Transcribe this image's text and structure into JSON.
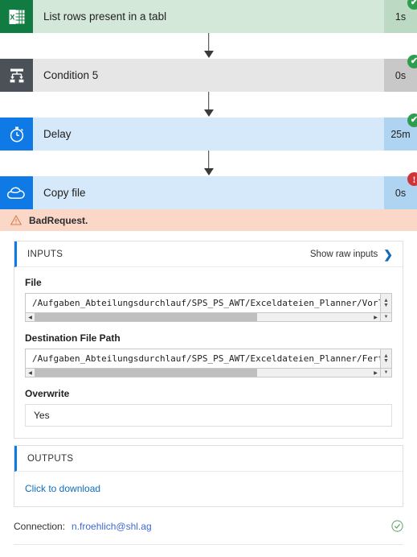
{
  "flow": {
    "steps": [
      {
        "name": "List rows present in a tabl",
        "duration": "1s",
        "status": "success",
        "icon": "excel-icon",
        "theme": "excel"
      },
      {
        "name": "Condition 5",
        "duration": "0s",
        "status": "success",
        "icon": "condition-icon",
        "theme": "condition"
      },
      {
        "name": "Delay",
        "duration": "25m",
        "status": "success",
        "icon": "stopwatch-icon",
        "theme": "blue"
      },
      {
        "name": "Copy file",
        "duration": "0s",
        "status": "error",
        "icon": "onedrive-cloud-icon",
        "theme": "blue"
      }
    ]
  },
  "error_banner": {
    "icon": "warning-triangle-icon",
    "message": "BadRequest."
  },
  "inputs_panel": {
    "title": "INPUTS",
    "raw_link_label": "Show raw inputs",
    "raw_link_icon": "chevron-right-icon",
    "fields": [
      {
        "label": "File",
        "value": "/Aufgaben_Abteilungsdurchlauf/SPS_PS_AWT/Exceldateien_Planner/Vorla",
        "has_scrollbar": true
      },
      {
        "label": "Destination File Path",
        "value": "/Aufgaben_Abteilungsdurchlauf/SPS_PS_AWT/Exceldateien_Planner/Ferti",
        "has_scrollbar": true
      },
      {
        "label": "Overwrite",
        "value": "Yes",
        "has_scrollbar": false
      }
    ]
  },
  "outputs_panel": {
    "title": "OUTPUTS",
    "download_label": "Click to download"
  },
  "connection": {
    "label": "Connection:",
    "account": "n.froehlich@shl.ag",
    "status_icon": "check-circle-icon"
  },
  "colors": {
    "excel_green": "#107c41",
    "excel_body": "#d3e8d8",
    "condition_gray": "#4a5159",
    "blue_accent": "#0f7ae5",
    "blue_body": "#d6e9fa",
    "error_red": "#d13438",
    "error_banner_bg": "#fbd7c7",
    "success_green": "#2d9e4d",
    "link_blue": "#0f6cbd"
  },
  "glyphs": {
    "check": "✔",
    "bang": "!",
    "chevron_right": "❯",
    "scroll_left": "◀",
    "scroll_right": "▶",
    "spin_up": "▲",
    "spin_down": "▼"
  }
}
